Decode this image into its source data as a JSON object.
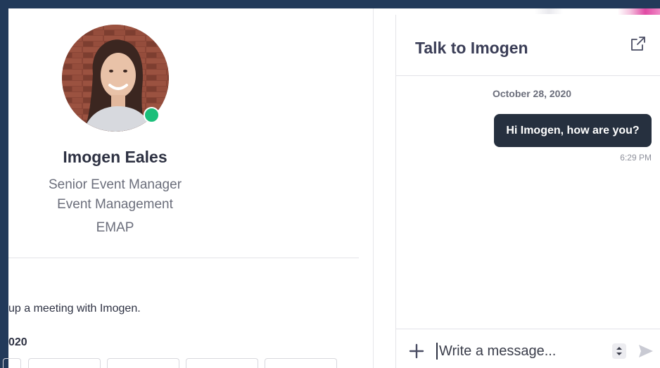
{
  "profile": {
    "name": "Imogen Eales",
    "job_title": "Senior Event Manager",
    "department": "Event Management",
    "organization": "EMAP",
    "status": "online",
    "status_color": "#1bbf7a",
    "meeting_text": "up a meeting with Imogen.",
    "date_fragment": "020"
  },
  "chat": {
    "title": "Talk to Imogen",
    "popout_icon": "external-link-icon",
    "date_separator": "October 28, 2020",
    "messages": [
      {
        "text": "Hi Imogen, how are you?",
        "time": "6:29 PM",
        "direction": "outgoing"
      }
    ],
    "composer": {
      "placeholder": "Write a message...",
      "add_icon": "plus-icon",
      "send_icon": "send-icon"
    }
  },
  "colors": {
    "frame": "#223a5a",
    "bubble": "#26303f",
    "accent_pink": "#e04aa4"
  }
}
